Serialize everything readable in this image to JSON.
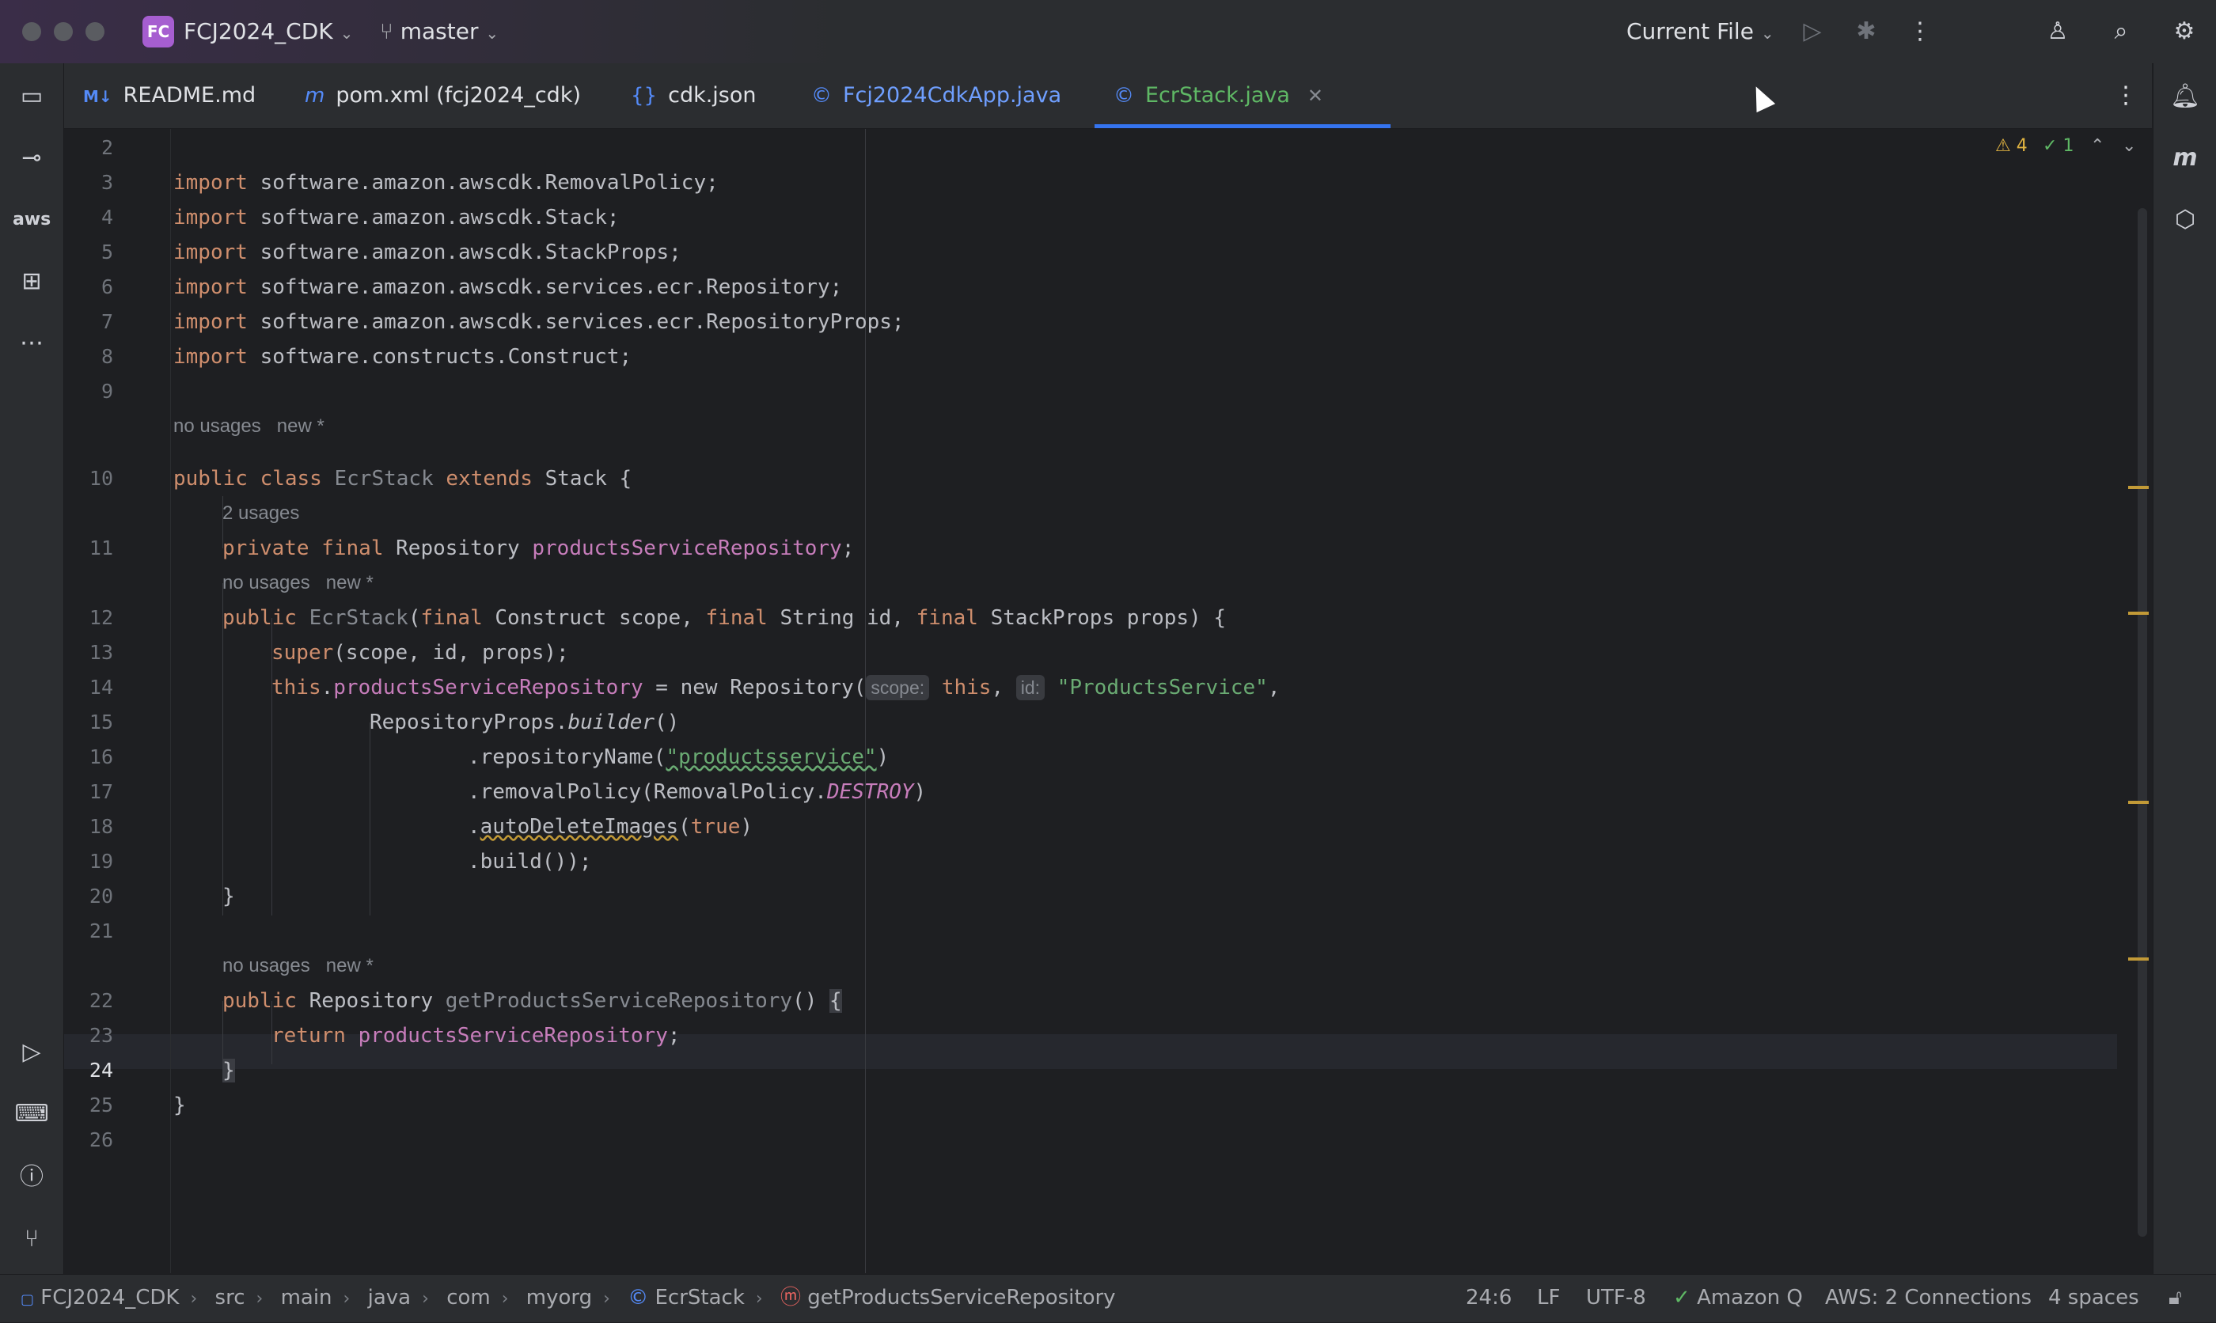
{
  "titlebar": {
    "project_badge": "FC",
    "project_name": "FCJ2024_CDK",
    "branch": "master",
    "run_config": "Current File"
  },
  "tabs": [
    {
      "label": "README.md",
      "icon": "M↓"
    },
    {
      "label": "pom.xml (fcj2024_cdk)",
      "icon": "m"
    },
    {
      "label": "cdk.json",
      "icon": "{}"
    },
    {
      "label": "Fcj2024CdkApp.java",
      "icon": "©"
    },
    {
      "label": "EcrStack.java",
      "icon": "©",
      "active": true
    }
  ],
  "inspections": {
    "warnings": "4",
    "ok": "1"
  },
  "line_numbers": [
    "2",
    "3",
    "4",
    "5",
    "6",
    "7",
    "8",
    "9",
    "10",
    "11",
    "12",
    "13",
    "14",
    "15",
    "16",
    "17",
    "18",
    "19",
    "20",
    "21",
    "22",
    "23",
    "24",
    "25",
    "26"
  ],
  "code": {
    "l3": "software.amazon.awscdk.RemovalPolicy;",
    "l4": "software.amazon.awscdk.Stack;",
    "l5": "software.amazon.awscdk.StackProps;",
    "l6": "software.amazon.awscdk.services.ecr.Repository;",
    "l7": "software.amazon.awscdk.services.ecr.RepositoryProps;",
    "l8": "software.constructs.Construct;",
    "kw_import": "import",
    "hint_10": "no usages   new *",
    "hint_11": "2 usages",
    "hint_12": "no usages   new *",
    "hint_22": "no usages   new *",
    "class_name": "EcrStack",
    "extends_type": "Stack",
    "field_name": "productsServiceRepository",
    "repo_type": "Repository",
    "ctor_name": "EcrStack",
    "p_construct": "Construct scope, ",
    "p_string": "String id, ",
    "p_props": "StackProps props) {",
    "super_args": "(scope, id, props);",
    "new_repo": " = new Repository(",
    "hint_scope": "scope:",
    "hint_id": "id:",
    "str_products": "\"ProductsService\"",
    "props_builder_pre": "RepositoryProps.",
    "props_builder": "builder",
    "props_builder_post": "()",
    "repo_name_call": ".repositoryName(",
    "repo_name_str": "\"productsservice\"",
    "removal_call": ".removalPolicy(RemovalPolicy.",
    "removal_destroy": "DESTROY",
    "auto_delete": "autoDeleteImages",
    "true_kw": "true",
    "build_call": ".build());",
    "getter_name": "getProductsServiceRepository",
    "return_kw": "return"
  },
  "statusbar": {
    "crumbs": [
      "FCJ2024_CDK",
      "src",
      "main",
      "java",
      "com",
      "myorg",
      "EcrStack",
      "getProductsServiceRepository"
    ],
    "position": "24:6",
    "line_sep": "LF",
    "encoding": "UTF-8",
    "amazon_q": "Amazon Q",
    "aws": "AWS: 2 Connections",
    "indent": "4 spaces"
  },
  "colors": {
    "accent": "#3574f0",
    "keyword": "#cf8e6d",
    "field": "#c77dbb",
    "string": "#6aab73"
  }
}
